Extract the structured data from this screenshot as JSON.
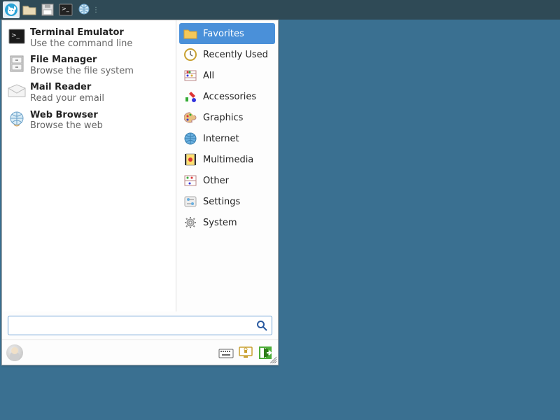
{
  "panel": {
    "items": [
      {
        "name": "whisker-menu-button",
        "icon": "mouse-icon"
      },
      {
        "name": "file-manager-launcher",
        "icon": "folder-icon"
      },
      {
        "name": "floppy-launcher",
        "icon": "floppy-icon"
      },
      {
        "name": "terminal-launcher",
        "icon": "terminal-icon"
      },
      {
        "name": "web-browser-launcher",
        "icon": "globe-hand-icon"
      }
    ]
  },
  "menu": {
    "apps": [
      {
        "title": "Terminal Emulator",
        "subtitle": "Use the command line",
        "icon": "terminal-icon"
      },
      {
        "title": "File Manager",
        "subtitle": "Browse the file system",
        "icon": "file-cabinet-icon"
      },
      {
        "title": "Mail Reader",
        "subtitle": "Read your email",
        "icon": "mail-icon"
      },
      {
        "title": "Web Browser",
        "subtitle": "Browse the web",
        "icon": "globe-hand-icon"
      }
    ],
    "categories": [
      {
        "label": "Favorites",
        "icon": "star-folder-icon",
        "selected": true
      },
      {
        "label": "Recently Used",
        "icon": "clock-icon",
        "selected": false
      },
      {
        "label": "All",
        "icon": "abacus-icon",
        "selected": false
      },
      {
        "label": "Accessories",
        "icon": "tools-color-icon",
        "selected": false
      },
      {
        "label": "Graphics",
        "icon": "palette-icon",
        "selected": false
      },
      {
        "label": "Internet",
        "icon": "globe-icon",
        "selected": false
      },
      {
        "label": "Multimedia",
        "icon": "film-icon",
        "selected": false
      },
      {
        "label": "Other",
        "icon": "abacus2-icon",
        "selected": false
      },
      {
        "label": "Settings",
        "icon": "sliders-icon",
        "selected": false
      },
      {
        "label": "System",
        "icon": "gear-icon",
        "selected": false
      }
    ],
    "search": {
      "value": "",
      "placeholder": ""
    },
    "footer": {
      "user_label": "",
      "actions": [
        {
          "name": "settings-editor-button",
          "icon": "keyboard-icon"
        },
        {
          "name": "lock-screen-button",
          "icon": "monitor-lock-icon"
        },
        {
          "name": "logout-button",
          "icon": "exit-icon"
        }
      ]
    }
  },
  "colors": {
    "accent": "#4a90d9",
    "panel": "#2f4a56",
    "desktop": "#3a7091"
  }
}
